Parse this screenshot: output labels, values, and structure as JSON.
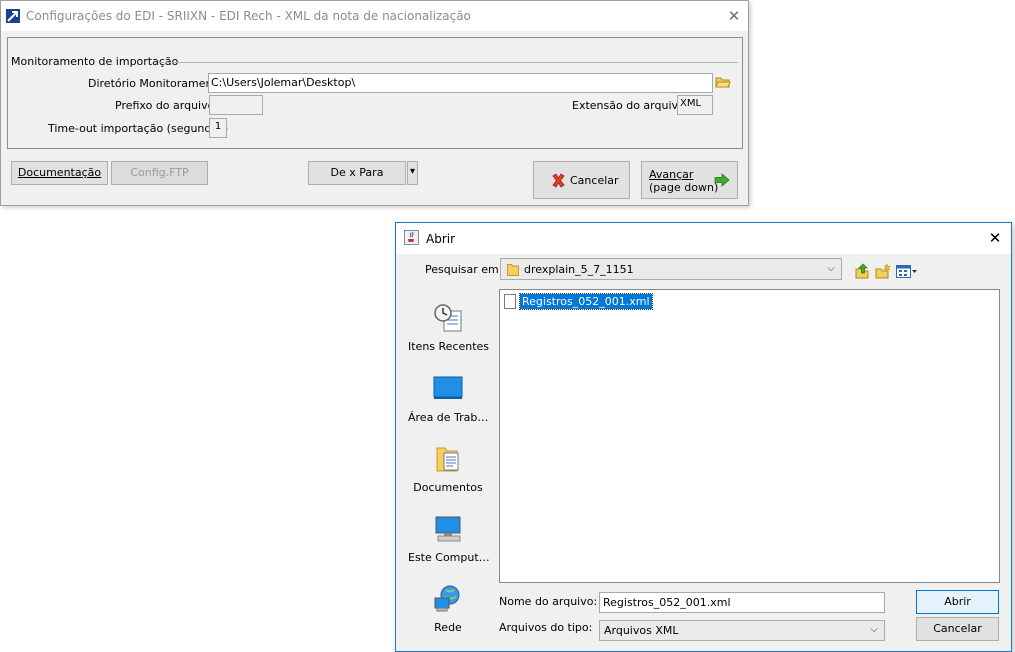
{
  "config_window": {
    "title": "Configurações do EDI - SRIIXN - EDI Rech - XML da nota de nacionalização",
    "close_glyph": "✕",
    "group": {
      "legend": "Monitoramento de importação",
      "dir_label": "Diretório Monitoramento",
      "dir_value": "C:\\Users\\Jolemar\\Desktop\\",
      "prefix_label": "Prefixo do arquivo",
      "prefix_value": "",
      "ext_label": "Extensão do arquivo",
      "ext_value": "XML",
      "timeout_label": "Time-out importação (segundos)",
      "timeout_value": "1"
    },
    "buttons": {
      "doc": "Documentação",
      "ftp": "Config.FTP",
      "dexpara": "De x Para",
      "dropdown_glyph": "▾",
      "cancel": "Cancelar",
      "next_line1": "Avançar",
      "next_line2": "(page down)"
    }
  },
  "open_dialog": {
    "title": "Abrir",
    "close_glyph": "✕",
    "lookin_label": "Pesquisar em:",
    "lookin_value": "drexplain_5_7_1151",
    "places": [
      {
        "label": "Itens Recentes",
        "icon": "recent-items-icon"
      },
      {
        "label": "Área de Trab…",
        "icon": "desktop-icon"
      },
      {
        "label": "Documentos",
        "icon": "documents-icon"
      },
      {
        "label": "Este Comput…",
        "icon": "computer-icon"
      },
      {
        "label": "Rede",
        "icon": "network-icon"
      }
    ],
    "files": [
      {
        "name": "Registros_052_001.xml",
        "selected": true
      }
    ],
    "filename_label": "Nome do arquivo:",
    "filename_value": "Registros_052_001.xml",
    "filetype_label": "Arquivos do tipo:",
    "filetype_value": "Arquivos XML",
    "open_button": "Abrir",
    "cancel_button": "Cancelar",
    "arrow_glyph": "⌵"
  },
  "colors": {
    "selection": "#0078d7",
    "dialog_border": "#1979ca",
    "cancel_icon": "#d9432f",
    "next_icon": "#3fae2a",
    "folder": "#f5cf5c"
  }
}
